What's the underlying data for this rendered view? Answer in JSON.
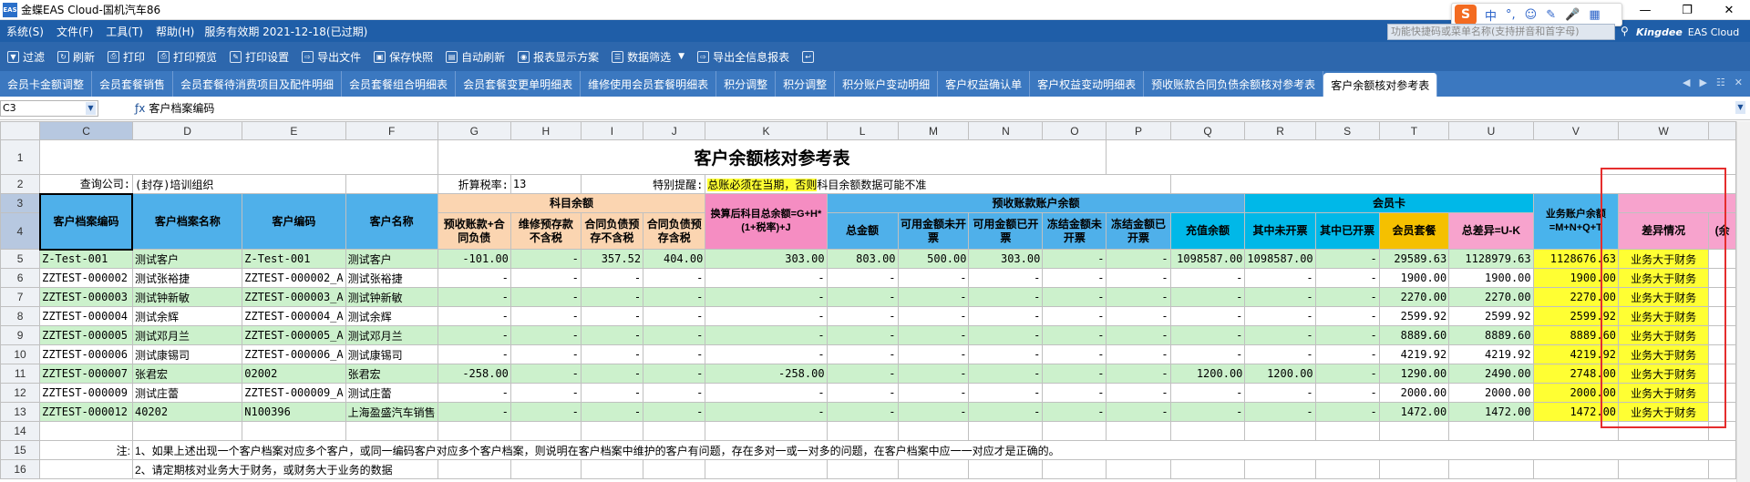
{
  "window": {
    "title": "金蝶EAS Cloud-国机汽车86",
    "app_icon": "EAS"
  },
  "menubar": {
    "items": [
      "系统(S)",
      "文件(F)",
      "工具(T)",
      "帮助(H)"
    ],
    "service_status": "服务有效期 2021-12-18(已过期)"
  },
  "search": {
    "placeholder": "功能快捷码或菜单名称(支持拼音和首字母)"
  },
  "brand": {
    "name": "Kingdee",
    "product": "EAS Cloud"
  },
  "toolbar": {
    "items": [
      "过滤",
      "刷新",
      "打印",
      "打印预览",
      "打印设置",
      "导出文件",
      "保存快照",
      "自动刷新",
      "报表显示方案",
      "数据筛选",
      "导出全信息报表"
    ]
  },
  "tabs": {
    "items": [
      "会员卡金额调整",
      "会员套餐销售",
      "会员套餐待消费项目及配件明细",
      "会员套餐组合明细表",
      "会员套餐变更单明细表",
      "维修使用会员套餐明细表",
      "积分调整",
      "积分调整",
      "积分账户变动明细",
      "客户权益确认单",
      "客户权益变动明细表",
      "预收账款合同负债余额核对参考表",
      "客户余额核对参考表"
    ],
    "active_index": 12
  },
  "formula": {
    "cell_ref": "C3",
    "content": "客户档案编码"
  },
  "grid": {
    "col_letters": [
      "C",
      "D",
      "E",
      "F",
      "G",
      "H",
      "I",
      "J",
      "K",
      "L",
      "M",
      "N",
      "O",
      "P",
      "Q",
      "R",
      "S",
      "T",
      "U",
      "V",
      "W"
    ],
    "row_numbers": [
      "1",
      "2",
      "3",
      "4",
      "5",
      "6",
      "7",
      "8",
      "9",
      "10",
      "11",
      "12",
      "13",
      "14",
      "15",
      "16"
    ],
    "title": "客户余额核对参考表",
    "query_company_label": "查询公司:",
    "query_company_value": "(封存)培训组织",
    "tax_label": "折算税率:",
    "tax_value": "13",
    "remind_label": "特别提醒:",
    "remind_highlight": "总账必须在当期，否则",
    "remind_rest": "科目余额数据可能不准",
    "headers": {
      "customer_code": "客户档案编码",
      "customer_name": "客户档案名称",
      "client_code": "客户编码",
      "client_name": "客户名称",
      "subject_balance": "科目余额",
      "prepaid_contract": "预收账款+合同负债",
      "repair_prepay": "维修预存款不含税",
      "contract_prepay_excl": "合同负债预存不含税",
      "contract_prepay_incl": "合同负债预存含税",
      "converted_total": "换算后科目总余额=G+H*(1+税率)+J",
      "prepaid_account": "预收账款账户余额",
      "total_amount": "总金额",
      "avail_uninvoiced": "可用金额未开票",
      "avail_invoiced": "可用金额已开票",
      "frozen_uninvoiced": "冻结金额未开票",
      "frozen_invoiced": "冻结金额已开票",
      "member_card": "会员卡",
      "recharge_balance": "充值余额",
      "of_uninvoiced": "其中未开票",
      "of_invoiced": "其中已开票",
      "member_package": "会员套餐",
      "business_balance": "业务账户余额=M+N+Q+T",
      "total_diff": "总差异=U-K",
      "diff_status": "差异情况",
      "extra_col": "(余"
    },
    "rows": [
      [
        "Z-Test-001",
        "测试客户",
        "Z-Test-001",
        "测试客户",
        "-101.00",
        "-",
        "357.52",
        "404.00",
        "303.00",
        "803.00",
        "500.00",
        "303.00",
        "-",
        "-",
        "1098587.00",
        "1098587.00",
        "-",
        "29589.63",
        "1128979.63",
        "1128676.63",
        "业务大于财务"
      ],
      [
        "ZZTEST-000002",
        "测试张裕捷",
        "ZZTEST-000002_A",
        "测试张裕捷",
        "-",
        "-",
        "-",
        "-",
        "-",
        "-",
        "-",
        "-",
        "-",
        "-",
        "-",
        "-",
        "-",
        "1900.00",
        "1900.00",
        "1900.00",
        "业务大于财务"
      ],
      [
        "ZZTEST-000003",
        "测试钟新敏",
        "ZZTEST-000003_A",
        "测试钟新敏",
        "-",
        "-",
        "-",
        "-",
        "-",
        "-",
        "-",
        "-",
        "-",
        "-",
        "-",
        "-",
        "-",
        "2270.00",
        "2270.00",
        "2270.00",
        "业务大于财务"
      ],
      [
        "ZZTEST-000004",
        "测试余辉",
        "ZZTEST-000004_A",
        "测试余辉",
        "-",
        "-",
        "-",
        "-",
        "-",
        "-",
        "-",
        "-",
        "-",
        "-",
        "-",
        "-",
        "-",
        "2599.92",
        "2599.92",
        "2599.92",
        "业务大于财务"
      ],
      [
        "ZZTEST-000005",
        "测试邓月兰",
        "ZZTEST-000005_A",
        "测试邓月兰",
        "-",
        "-",
        "-",
        "-",
        "-",
        "-",
        "-",
        "-",
        "-",
        "-",
        "-",
        "-",
        "-",
        "8889.60",
        "8889.60",
        "8889.60",
        "业务大于财务"
      ],
      [
        "ZZTEST-000006",
        "测试康锡司",
        "ZZTEST-000006_A",
        "测试康锡司",
        "-",
        "-",
        "-",
        "-",
        "-",
        "-",
        "-",
        "-",
        "-",
        "-",
        "-",
        "-",
        "-",
        "4219.92",
        "4219.92",
        "4219.92",
        "业务大于财务"
      ],
      [
        "ZZTEST-000007",
        "张君宏",
        "02002",
        "张君宏",
        "-258.00",
        "-",
        "-",
        "-",
        "-258.00",
        "-",
        "-",
        "-",
        "-",
        "-",
        "1200.00",
        "1200.00",
        "-",
        "1290.00",
        "2490.00",
        "2748.00",
        "业务大于财务"
      ],
      [
        "ZZTEST-000009",
        "测试庄蕾",
        "ZZTEST-000009_A",
        "测试庄蕾",
        "-",
        "-",
        "-",
        "-",
        "-",
        "-",
        "-",
        "-",
        "-",
        "-",
        "-",
        "-",
        "-",
        "2000.00",
        "2000.00",
        "2000.00",
        "业务大于财务"
      ],
      [
        "ZZTEST-000012",
        "40202",
        "N100396",
        "上海盈盛汽车销售",
        "-",
        "-",
        "-",
        "-",
        "-",
        "-",
        "-",
        "-",
        "-",
        "-",
        "-",
        "-",
        "-",
        "1472.00",
        "1472.00",
        "1472.00",
        "业务大于财务"
      ]
    ],
    "note_label": "注:",
    "note1": "1、如果上述出现一个客户档案对应多个客户，或同一编码客户对应多个客户档案，则说明在客户档案中维护的客户有问题，存在多对一或一对多的问题，在客户档案中应一一对应才是正确的。",
    "note2": "2、请定期核对业务大于财务，或财务大于业务的数据"
  }
}
